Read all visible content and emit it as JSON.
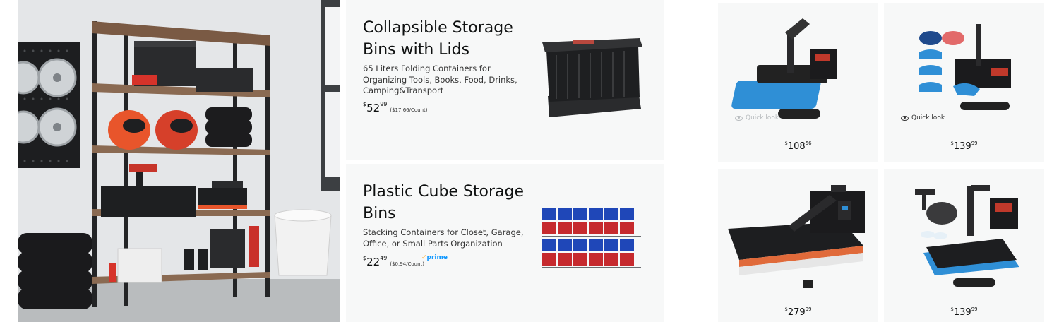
{
  "hero": {
    "alt_name": "garage-shelving-image"
  },
  "cards": [
    {
      "title": "Collapsible Storage Bins with Lids",
      "description": "65 Liters Folding Containers for Organizing Tools, Books, Food, Drinks, Camping&Transport",
      "price": {
        "symbol": "$",
        "whole": "52",
        "fraction": "99",
        "unit": "($17.66/Count)"
      },
      "prime": ""
    },
    {
      "title": "Plastic Cube Storage Bins",
      "description": "Stacking Containers for Closet, Garage, Office, or Small Parts Organization",
      "price": {
        "symbol": "$",
        "whole": "22",
        "fraction": "49",
        "unit": "($0.94/Count)"
      },
      "prime": "prime"
    }
  ],
  "tiles": [
    {
      "price": {
        "symbol": "$",
        "whole": "108",
        "fraction": "56"
      },
      "quick_look": "Quick look",
      "quick_look_state": "faded"
    },
    {
      "price": {
        "symbol": "$",
        "whole": "139",
        "fraction": "99"
      },
      "quick_look": "Quick look",
      "quick_look_state": "active"
    },
    {
      "price": {
        "symbol": "$",
        "whole": "279",
        "fraction": "99"
      }
    },
    {
      "price": {
        "symbol": "$",
        "whole": "139",
        "fraction": "99"
      }
    }
  ],
  "colors": {
    "card_bg": "#f7f8f8",
    "prime_blue": "#1399ff",
    "prime_check": "#ff9900",
    "press_blue": "#2f8fd6"
  }
}
